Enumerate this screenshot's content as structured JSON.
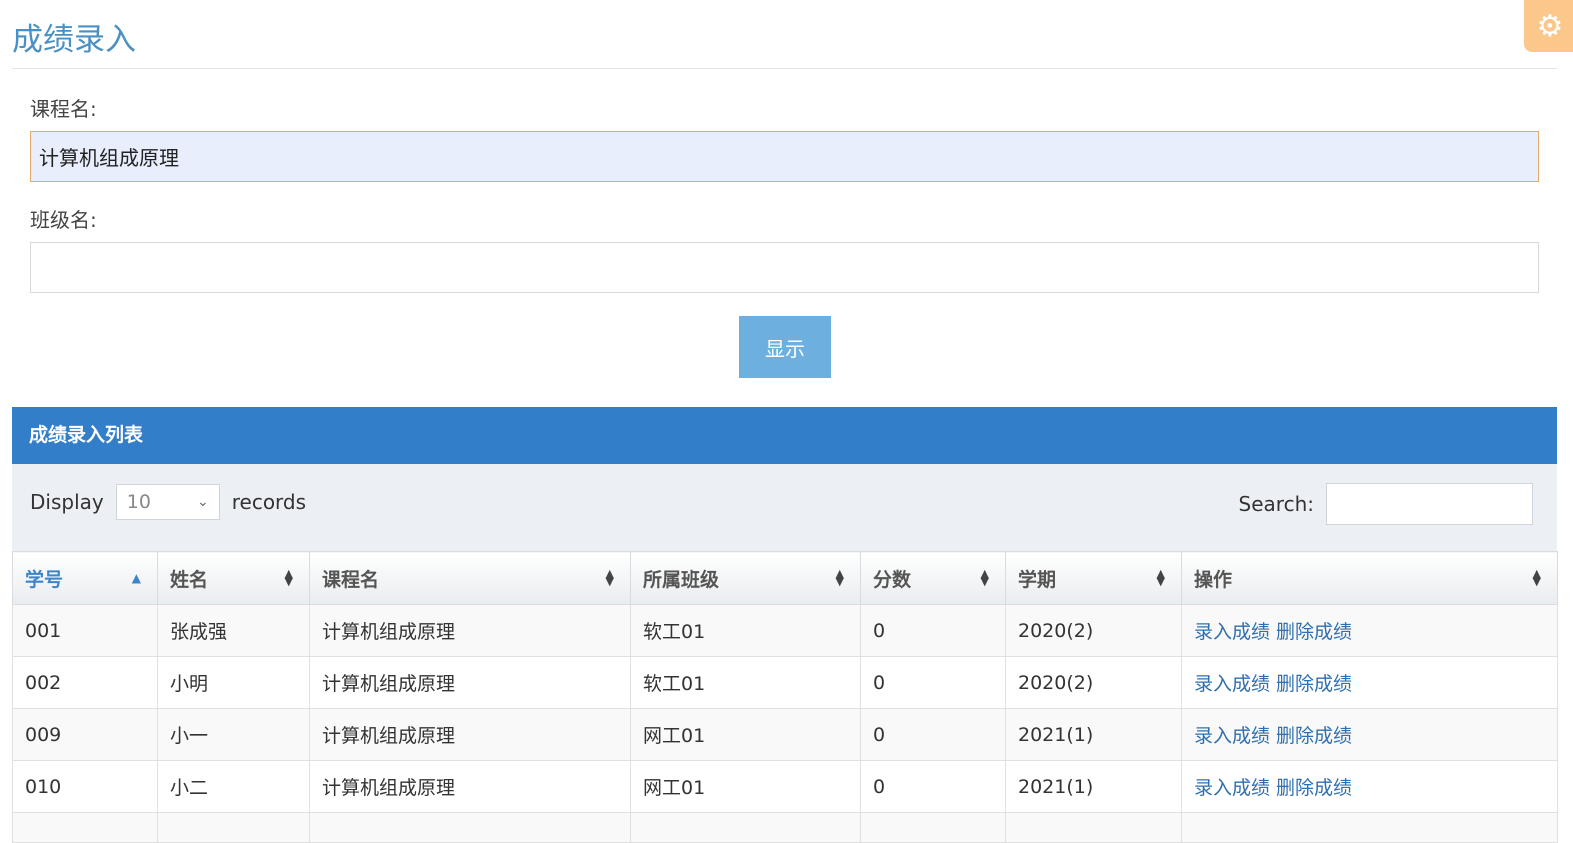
{
  "header": {
    "title": "成绩录入",
    "settings_icon": "gear-icon",
    "settings_color": "#fbc78a"
  },
  "form": {
    "course_label": "课程名:",
    "course_value": "计算机组成原理",
    "class_label": "班级名:",
    "class_value": "",
    "show_button": "显示"
  },
  "panel": {
    "title": "成绩录入列表",
    "header_color": "#327ec9"
  },
  "controls": {
    "display_label": "Display",
    "page_size": "10",
    "records_label": "records",
    "search_label": "Search:",
    "search_value": ""
  },
  "table": {
    "columns": [
      "学号",
      "姓名",
      "课程名",
      "所属班级",
      "分数",
      "学期",
      "操作"
    ],
    "rows": [
      {
        "id": "001",
        "name": "张成强",
        "course": "计算机组成原理",
        "class": "软工01",
        "score": "0",
        "term": "2020(2)",
        "action_enter": "录入成绩",
        "action_delete": "删除成绩"
      },
      {
        "id": "002",
        "name": "小明",
        "course": "计算机组成原理",
        "class": "软工01",
        "score": "0",
        "term": "2020(2)",
        "action_enter": "录入成绩",
        "action_delete": "删除成绩"
      },
      {
        "id": "009",
        "name": "小一",
        "course": "计算机组成原理",
        "class": "网工01",
        "score": "0",
        "term": "2021(1)",
        "action_enter": "录入成绩",
        "action_delete": "删除成绩"
      },
      {
        "id": "010",
        "name": "小二",
        "course": "计算机组成原理",
        "class": "网工01",
        "score": "0",
        "term": "2021(1)",
        "action_enter": "录入成绩",
        "action_delete": "删除成绩"
      }
    ]
  }
}
